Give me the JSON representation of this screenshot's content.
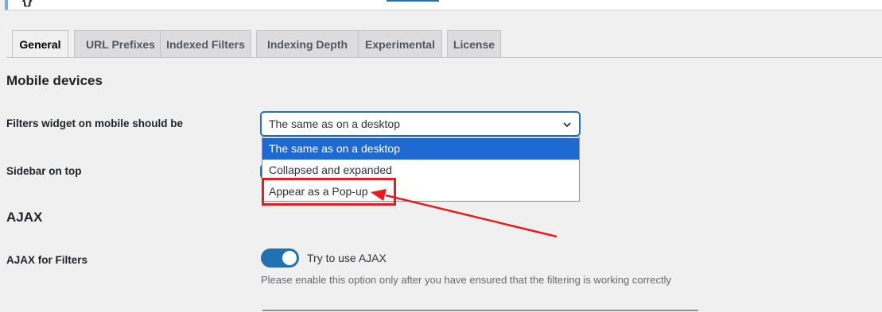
{
  "tabs": [
    {
      "label": "General",
      "active": true
    },
    {
      "label": "URL Prefixes",
      "active": false
    },
    {
      "label": "Indexed Filters",
      "active": false
    },
    {
      "label": "Indexing Depth",
      "active": false
    },
    {
      "label": "Experimental",
      "active": false
    },
    {
      "label": "License",
      "active": false
    }
  ],
  "mobile": {
    "title": "Mobile devices",
    "filters_widget_label": "Filters widget on mobile should be",
    "select_value": "The same as on a desktop",
    "options": [
      "The same as on a desktop",
      "Collapsed and expanded",
      "Appear as a Pop-up"
    ],
    "sidebar_on_top_label": "Sidebar on top"
  },
  "ajax": {
    "title": "AJAX",
    "label": "AJAX for Filters",
    "toggle_label": "Try to use AJAX",
    "toggle_on": true,
    "description": "Please enable this option only after you have ensured that the filtering is working correctly"
  },
  "colors": {
    "accent": "#2271b1",
    "selected_option": "#1e69d2",
    "annotation_red": "#e21e1e"
  }
}
